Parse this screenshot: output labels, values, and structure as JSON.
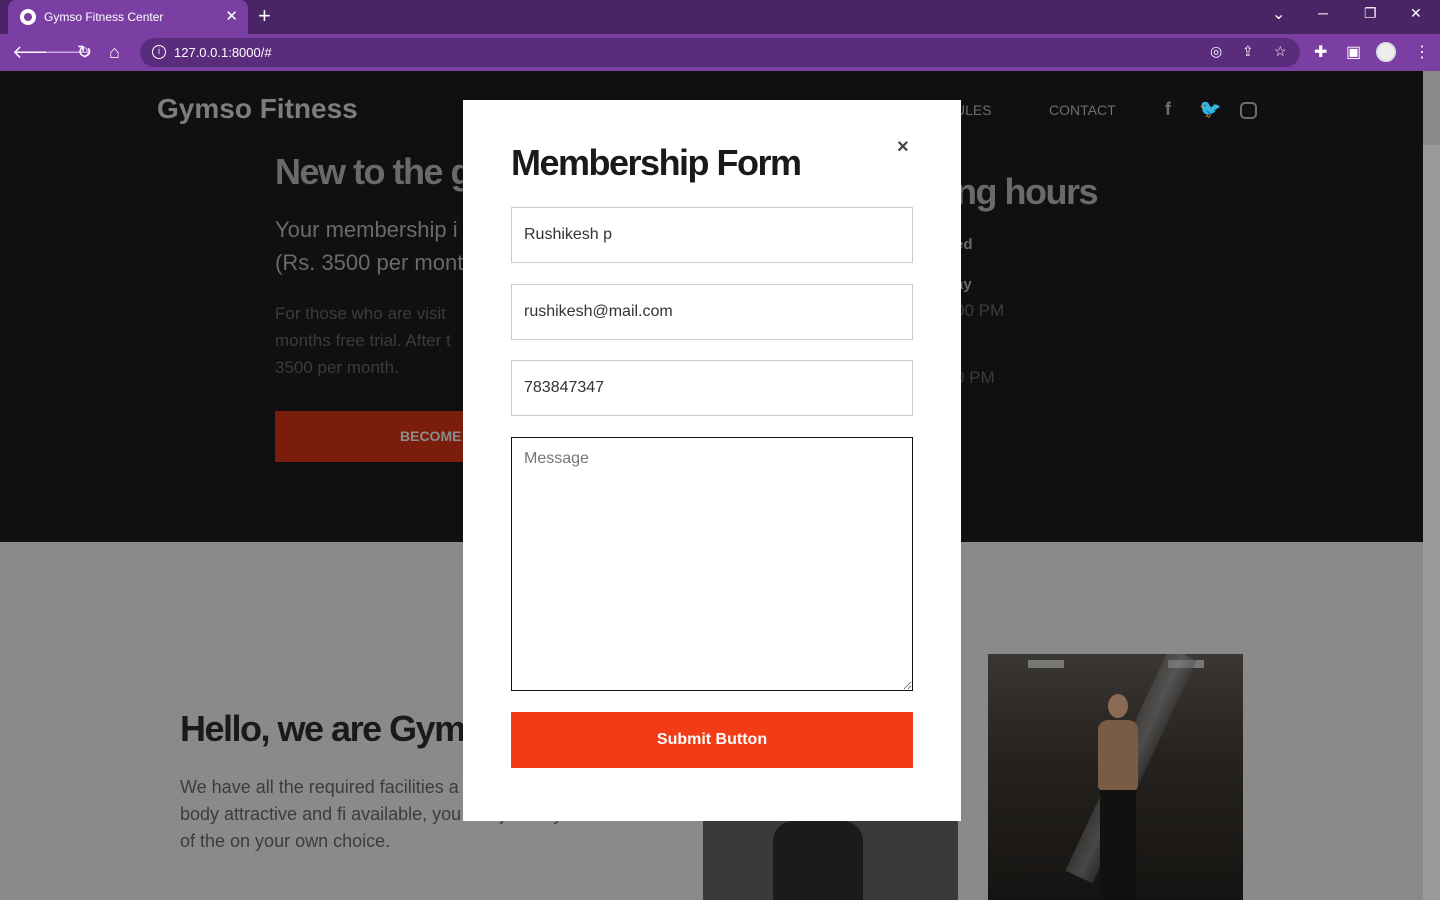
{
  "browser": {
    "tab_title": "Gymso Fitness Center",
    "tab_close": "✕",
    "new_tab": "+",
    "url": "127.0.0.1:8000/#",
    "win_min": "─",
    "win_restore": "❐",
    "win_close": "✕",
    "win_dropdown": "⌄"
  },
  "site": {
    "brand": "Gymso Fitness",
    "nav": [
      "ULES",
      "CONTACT"
    ],
    "social_icons": [
      "facebook-icon",
      "twitter-icon",
      "instagram-icon"
    ],
    "hero_left": {
      "heading": "New to the g",
      "subtitle_line1": "Your membership i",
      "subtitle_line2": "(Rs. 3500 per mont",
      "para_line1": "For those who are visit",
      "para_line2": "months free trial. After t",
      "para_line3": "3500 per month.",
      "button": "BECOME"
    },
    "hero_right": {
      "heading": "ng hours",
      "line1": "ed",
      "line2": "ay",
      "time1": "00 PM",
      "time2": "0 PM"
    },
    "about": {
      "heading": "Hello, we are Gym",
      "para": "We have all the required facilities a to make your body attractive and fi available, you can join any one of the on your own choice."
    }
  },
  "modal": {
    "title": "Membership Form",
    "close": "×",
    "name_value": "Rushikesh p",
    "email_value": "rushikesh@mail.com",
    "phone_value": "783847347",
    "message_placeholder": "Message",
    "submit_label": "Submit Button"
  }
}
